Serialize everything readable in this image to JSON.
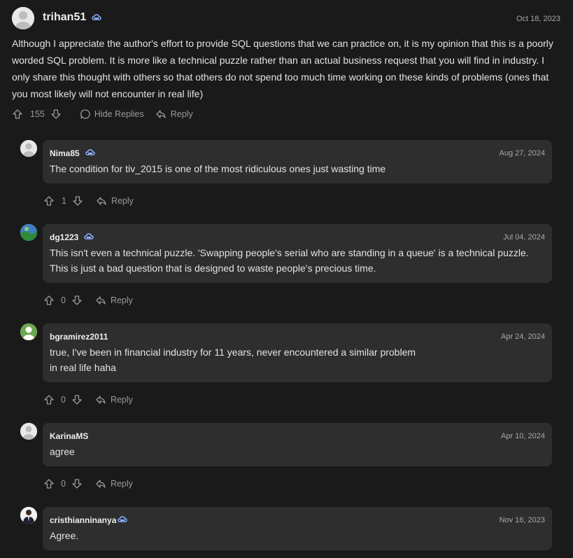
{
  "main": {
    "username": "trihan51",
    "date": "Oct 18, 2023",
    "text": "Although I appreciate the author's effort to provide SQL questions that we can practice on, it is my opinion that this is a poorly worded SQL problem. It is more like a technical puzzle rather than an actual business request that you will find in industry. I only share this thought with others so that others do not spend too much time working on these kinds of problems (ones that you most likely will not encounter in real life)",
    "votes": "155",
    "hide_replies": "Hide Replies",
    "reply": "Reply"
  },
  "replies": [
    {
      "username": "Nima85",
      "date": "Aug 27, 2024",
      "text": "The condition for tiv_2015 is one of the most ridiculous ones just wasting time",
      "votes": "1",
      "reply": "Reply"
    },
    {
      "username": "dg1223",
      "date": "Jul 04, 2024",
      "text": "This isn't even a technical puzzle. 'Swapping people's serial who are standing in a queue' is a technical puzzle. This is just a bad question that is designed to waste people's precious time.",
      "votes": "0",
      "reply": "Reply"
    },
    {
      "username": "bgramirez2011",
      "date": "Apr 24, 2024",
      "text1": "true, I've been in financial industry for 11 years, never encountered a similar problem",
      "text2": "in real life haha",
      "votes": "0",
      "reply": "Reply"
    },
    {
      "username": "KarinaMS",
      "date": "Apr 10, 2024",
      "text": "agree",
      "votes": "0",
      "reply": "Reply"
    },
    {
      "username": "cristhianninanya",
      "date": "Nov 16, 2023",
      "text": "Agree."
    }
  ],
  "colors": {
    "background": "#1a1a1a",
    "card": "#2e2e2e",
    "badge": "#8fb3ff"
  }
}
